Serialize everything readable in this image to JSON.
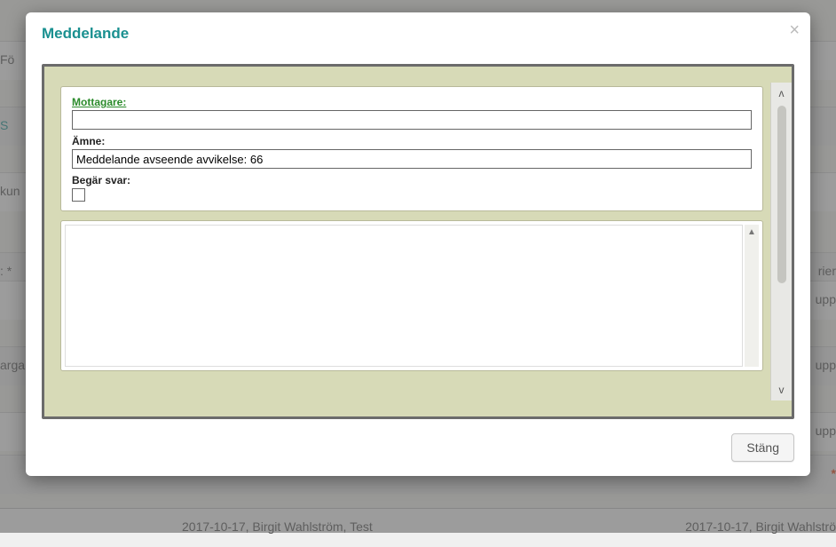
{
  "modal": {
    "title": "Meddelande",
    "close_icon": "×",
    "close_button": "Stäng"
  },
  "form": {
    "recipient_label": "Mottagare:",
    "recipient_value": "",
    "subject_label": "Ämne:",
    "subject_value": "Meddelande avseende avvikelse: 66",
    "request_reply_label": "Begär svar:",
    "request_reply_checked": false,
    "body_value": ""
  },
  "background": {
    "entry1": "2017-10-17, Birgit Wahlström, Test",
    "entry2": "2017-10-17, Birgit Wahlströ",
    "frag_fo": "Fö",
    "frag_s": "S",
    "frag_kun": "kun",
    "frag_star": ": *",
    "frag_arga": "arga",
    "frag_rier": "rier",
    "frag_upp": "upp",
    "frag_star2": "*"
  }
}
